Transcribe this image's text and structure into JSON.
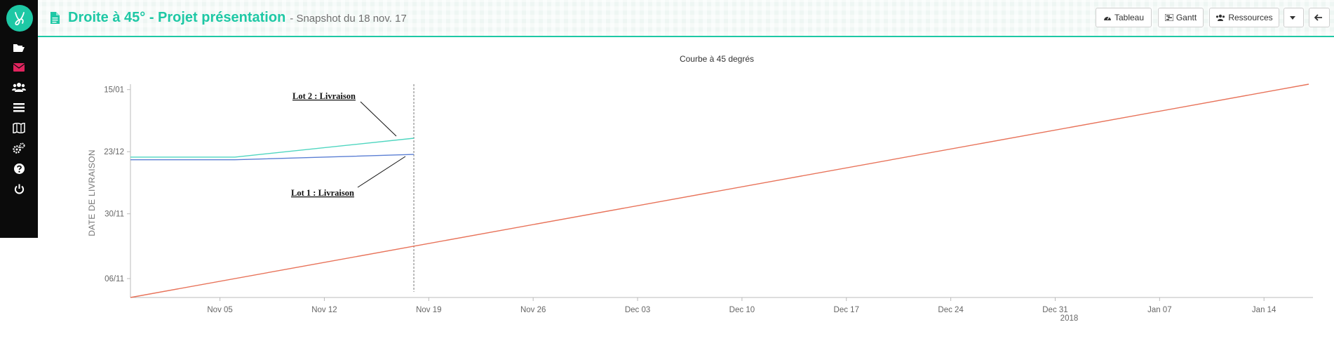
{
  "app": {
    "logo_label": "Y"
  },
  "sidebar": {
    "items": [
      {
        "name": "folder-open-icon"
      },
      {
        "name": "envelope-icon",
        "color": "#e0245e"
      },
      {
        "name": "users-icon"
      },
      {
        "name": "list-icon"
      },
      {
        "name": "map-icon"
      },
      {
        "name": "cogs-icon"
      },
      {
        "name": "question-icon"
      },
      {
        "name": "power-icon"
      }
    ]
  },
  "header": {
    "title": "Droite à 45° - Projet présentation",
    "subtitle": "- Snapshot du 18 nov. 17",
    "buttons": {
      "tableau": "Tableau",
      "gantt": "Gantt",
      "ressources": "Ressources"
    }
  },
  "colors": {
    "accent": "#1ec8a5",
    "series_ref": "#e8735a",
    "series_lot1": "#5b7fd4",
    "series_lot2": "#4fd6c0"
  },
  "chart_data": {
    "type": "line",
    "title": "Courbe à 45 degrés",
    "ylabel": "DATE DE LIVRAISON",
    "xlabel": "",
    "x_ticks": [
      "Nov 05",
      "Nov 12",
      "Nov 19",
      "Nov 26",
      "Dec 03",
      "Dec 10",
      "Dec 17",
      "Dec 24",
      "Dec 31",
      "Jan 07",
      "Jan 14"
    ],
    "x_year_label": "2018",
    "y_ticks": [
      "15/01",
      "23/12",
      "30/11",
      "06/11"
    ],
    "snapshot_date": "2017-11-18",
    "series": [
      {
        "key": "reference",
        "points": [
          [
            "2017-10-30",
            "2017-10-30"
          ],
          [
            "2018-01-17",
            "2018-01-17"
          ]
        ]
      },
      {
        "key": "lot1",
        "name": "Lot 1 : Livraison",
        "points": [
          [
            "2017-10-30",
            "2017-12-20"
          ],
          [
            "2017-11-06",
            "2017-12-20"
          ],
          [
            "2017-11-18",
            "2017-12-22"
          ]
        ]
      },
      {
        "key": "lot2",
        "name": "Lot 2 : Livraison",
        "points": [
          [
            "2017-10-30",
            "2017-12-21"
          ],
          [
            "2017-11-06",
            "2017-12-21"
          ],
          [
            "2017-11-18",
            "2017-12-28"
          ]
        ]
      }
    ]
  }
}
